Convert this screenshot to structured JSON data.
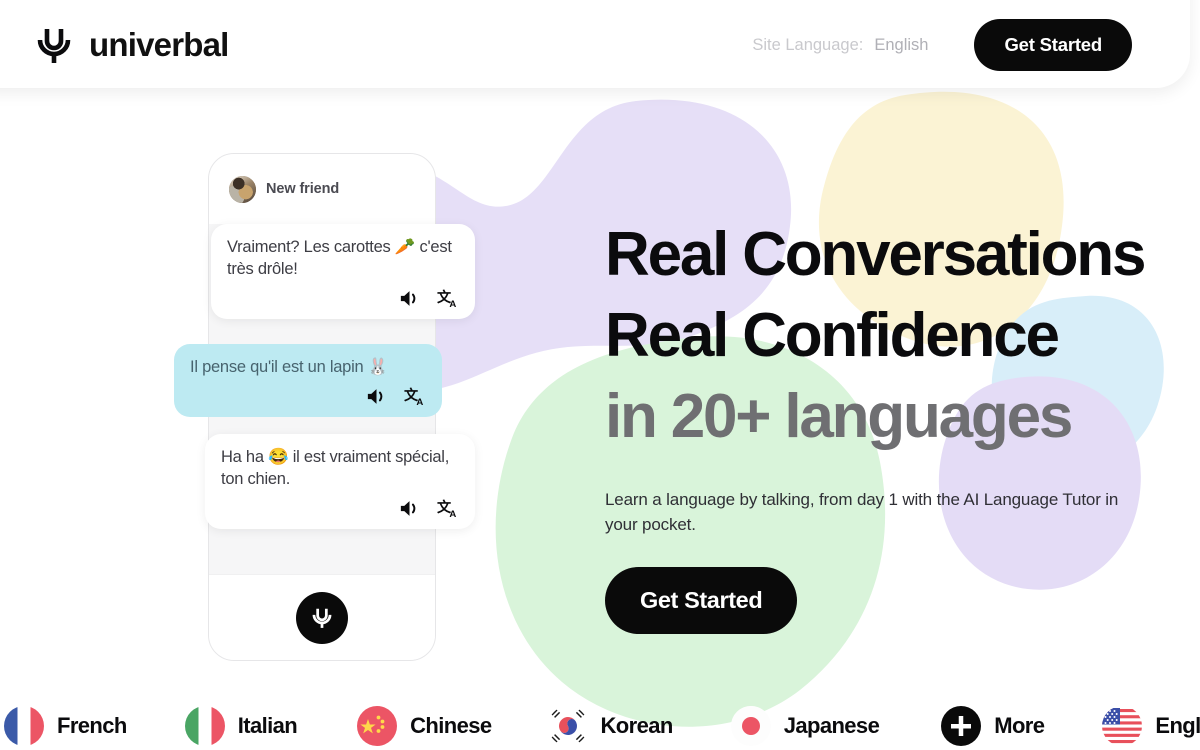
{
  "header": {
    "brand_name": "univerbal",
    "brand_icon": "microphone-logo-icon",
    "site_language_label": "Site Language:",
    "site_language_value": "English",
    "cta_label": "Get Started"
  },
  "phone": {
    "contact_name": "New friend",
    "avatar_icon": "user-avatar-photo",
    "mic_icon": "microphone-icon",
    "messages": [
      {
        "id": "bubble-1",
        "side": "in",
        "text": "Vraiment? Les carottes 🥕 c'est très drôle!",
        "speaker_icon": "speaker-icon",
        "translate_icon": "translate-icon"
      },
      {
        "id": "bubble-2",
        "side": "out",
        "text": "Il pense qu'il est un lapin 🐰",
        "speaker_icon": "speaker-icon",
        "translate_icon": "translate-icon"
      },
      {
        "id": "bubble-3",
        "side": "in",
        "text": "Ha ha 😂 il est vraiment spécial, ton chien.",
        "speaker_icon": "speaker-icon",
        "translate_icon": "translate-icon"
      }
    ]
  },
  "hero": {
    "headline_line_1": "Real Conversations",
    "headline_line_2": "Real Confidence",
    "headline_line_3": "in 20+ languages",
    "subtitle": "Learn a language by talking, from day 1 with the AI Language Tutor in your pocket.",
    "cta_label": "Get Started"
  },
  "languages": [
    {
      "label": "French",
      "flag": "flag-france-icon"
    },
    {
      "label": "Italian",
      "flag": "flag-italy-icon"
    },
    {
      "label": "Chinese",
      "flag": "flag-china-icon"
    },
    {
      "label": "Korean",
      "flag": "flag-south-korea-icon"
    },
    {
      "label": "Japanese",
      "flag": "flag-japan-icon"
    },
    {
      "label": "More",
      "flag": "plus-circle-icon"
    },
    {
      "label": "English",
      "flag": "flag-usa-icon"
    }
  ],
  "colors": {
    "accent_black": "#0a0a0a",
    "bubble_out_bg": "#bdeaf2",
    "bubble_out_text": "#47636e",
    "headline_muted": "#6f6f72",
    "blob_purple": "#e4dcf6",
    "blob_cream": "#fbf3d4",
    "blob_green": "#d9f4da",
    "blob_blue": "#d7edf8"
  }
}
